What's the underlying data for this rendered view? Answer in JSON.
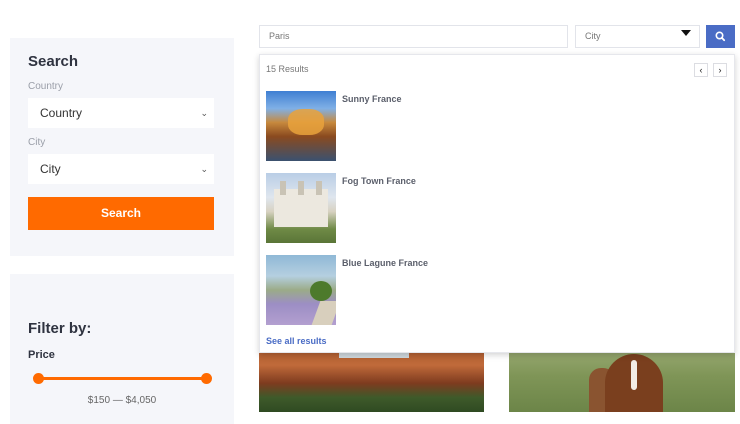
{
  "search_panel": {
    "title": "Search",
    "country_label": "Country",
    "country_value": "Country",
    "city_label": "City",
    "city_value": "City",
    "search_button": "Search"
  },
  "filter_panel": {
    "title": "Filter by:",
    "price_label": "Price",
    "price_range": "$150 — $4,050",
    "slider_min_fraction": 0,
    "slider_max_fraction": 1
  },
  "top_bar": {
    "search_value": "Paris",
    "city_value": "City",
    "search_icon": "search-icon"
  },
  "dropdown": {
    "results_count": "15 Results",
    "prev_icon": "chevron-left-icon",
    "next_icon": "chevron-right-icon",
    "results": [
      {
        "name": "Sunny France"
      },
      {
        "name": "Fog Town France"
      },
      {
        "name": "Blue Lagune France"
      }
    ],
    "see_all": "See all results"
  },
  "colors": {
    "accent_orange": "#ff6a00",
    "accent_blue": "#4a6cc5",
    "panel_bg": "#f5f6fa"
  }
}
